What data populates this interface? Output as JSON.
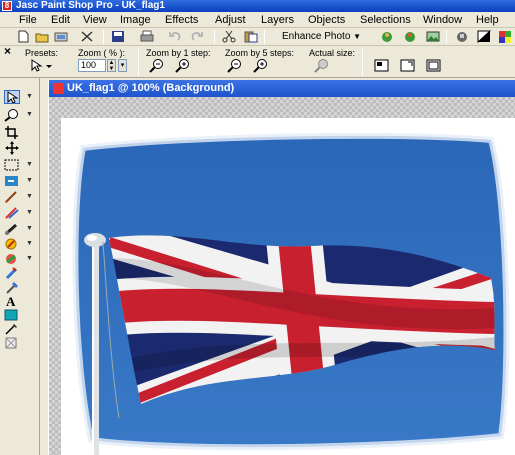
{
  "app": {
    "title": "Jasc Paint Shop Pro - UK_flag1",
    "logo_glyph": "8"
  },
  "menu": {
    "items": [
      "File",
      "Edit",
      "View",
      "Image",
      "Effects",
      "Adjust",
      "Layers",
      "Objects",
      "Selections",
      "Window",
      "Help"
    ]
  },
  "toolbar": {
    "enhance_label": "Enhance Photo"
  },
  "options": {
    "presets_label": "Presets:",
    "zoom_label": "Zoom ( % ):",
    "zoom_value": "100",
    "zoom1_label": "Zoom by 1 step:",
    "zoom5_label": "Zoom by 5 steps:",
    "actual_label": "Actual size:"
  },
  "document": {
    "title": "UK_flag1 @ 100% (Background)"
  },
  "colors": {
    "titlebar": "#0a3fbf",
    "sky": "#2f6fbd",
    "flag_blue": "#1b2a6e",
    "flag_red": "#c8202f"
  }
}
